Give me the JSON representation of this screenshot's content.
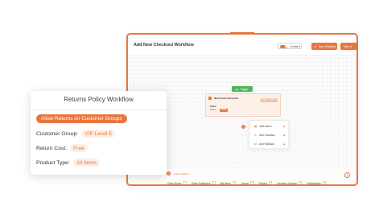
{
  "workflow": {
    "title": "Add New Checkout Workflow",
    "toggle_label": "Enabled",
    "save_label": "Save Workflow",
    "extra_label": "Save &"
  },
  "canvas": {
    "trigger_label": "Trigger",
    "node": {
      "title": "New Order Received",
      "link": "Add Trigger Filter",
      "field_label": "Order",
      "sub_label": "Paid In",
      "sub_value": "Stripe"
    },
    "menu": [
      {
        "icon": "action-icon",
        "label": "Add Action"
      },
      {
        "icon": "condition-icon",
        "label": "Add Condition"
      },
      {
        "icon": "rollback-icon",
        "label": "Add Rollback"
      }
    ]
  },
  "bottom": {
    "add_condition": "Add Condition",
    "chips": [
      "Order Roles",
      "Order Fulfillment",
      "Bill Items",
      "Cancel",
      "Refund",
      "Payment Options",
      "Notifications"
    ]
  },
  "card": {
    "title": "Returns Policy Workflow",
    "allow_label": "Allow Returns on Customer Groups",
    "rows": [
      {
        "key": "Customer Group:",
        "value": "VIP Level 5"
      },
      {
        "key": "Return Cost:",
        "value": "Free"
      },
      {
        "key": "Product Type:",
        "value": "All Items"
      }
    ]
  },
  "colors": {
    "accent": "#e8773f",
    "trigger": "#53b359"
  }
}
